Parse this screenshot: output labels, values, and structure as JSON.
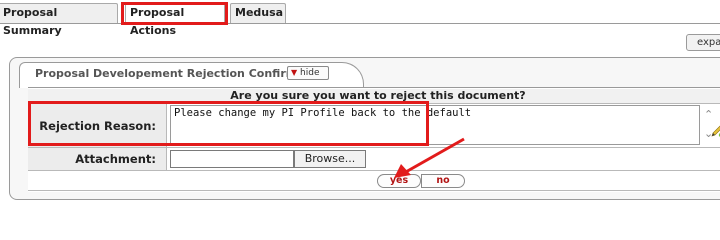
{
  "tabs": [
    {
      "label": "Proposal Summary",
      "active": false
    },
    {
      "label": "Proposal Actions",
      "active": true
    },
    {
      "label": "Medusa",
      "active": false
    }
  ],
  "expand_label": "expand all",
  "panel": {
    "title": "Proposal Developement Rejection Confirmation",
    "hide_label": "hide"
  },
  "form": {
    "question": "Are you sure you want to reject this document?",
    "reason_label": "Rejection Reason:",
    "reason_value": "Please change my PI Profile back to the default",
    "attachment_label": "Attachment:",
    "browse_label": "Browse...",
    "yes_label": "yes",
    "no_label": "no"
  },
  "colors": {
    "highlight": "#e21b1b",
    "button_text": "#b21414"
  },
  "icons": {
    "hide": "triangle-down-icon",
    "reason_tool": "pencil-icon",
    "annotation": "red-arrow-icon"
  }
}
